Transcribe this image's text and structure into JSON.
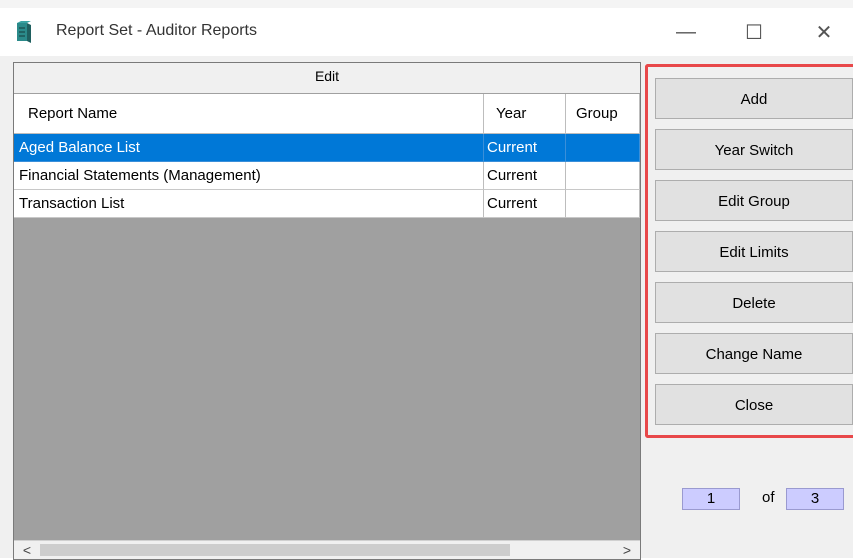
{
  "window": {
    "title": "Report Set - Auditor Reports",
    "controls": {
      "minimize": "—",
      "maximize": "☐",
      "close": "✕"
    }
  },
  "grid": {
    "section_label": "Edit",
    "columns": [
      "Report Name",
      "Year",
      "Group"
    ],
    "rows": [
      {
        "name": "Aged Balance List",
        "year": "Current",
        "group": "",
        "selected": true
      },
      {
        "name": "Financial Statements (Management)",
        "year": "Current",
        "group": "",
        "selected": false
      },
      {
        "name": "Transaction List",
        "year": "Current",
        "group": "",
        "selected": false
      }
    ],
    "scroll_left": "<",
    "scroll_right": ">"
  },
  "actions": {
    "add": "Add",
    "year_switch": "Year Switch",
    "edit_group": "Edit Group",
    "edit_limits": "Edit Limits",
    "delete": "Delete",
    "change_name": "Change Name",
    "close": "Close"
  },
  "pager": {
    "current": "1",
    "of_label": "of",
    "total": "3"
  },
  "colors": {
    "selection": "#0078d7",
    "highlight_border": "#e8484a",
    "pager_bg": "#ccccff"
  }
}
